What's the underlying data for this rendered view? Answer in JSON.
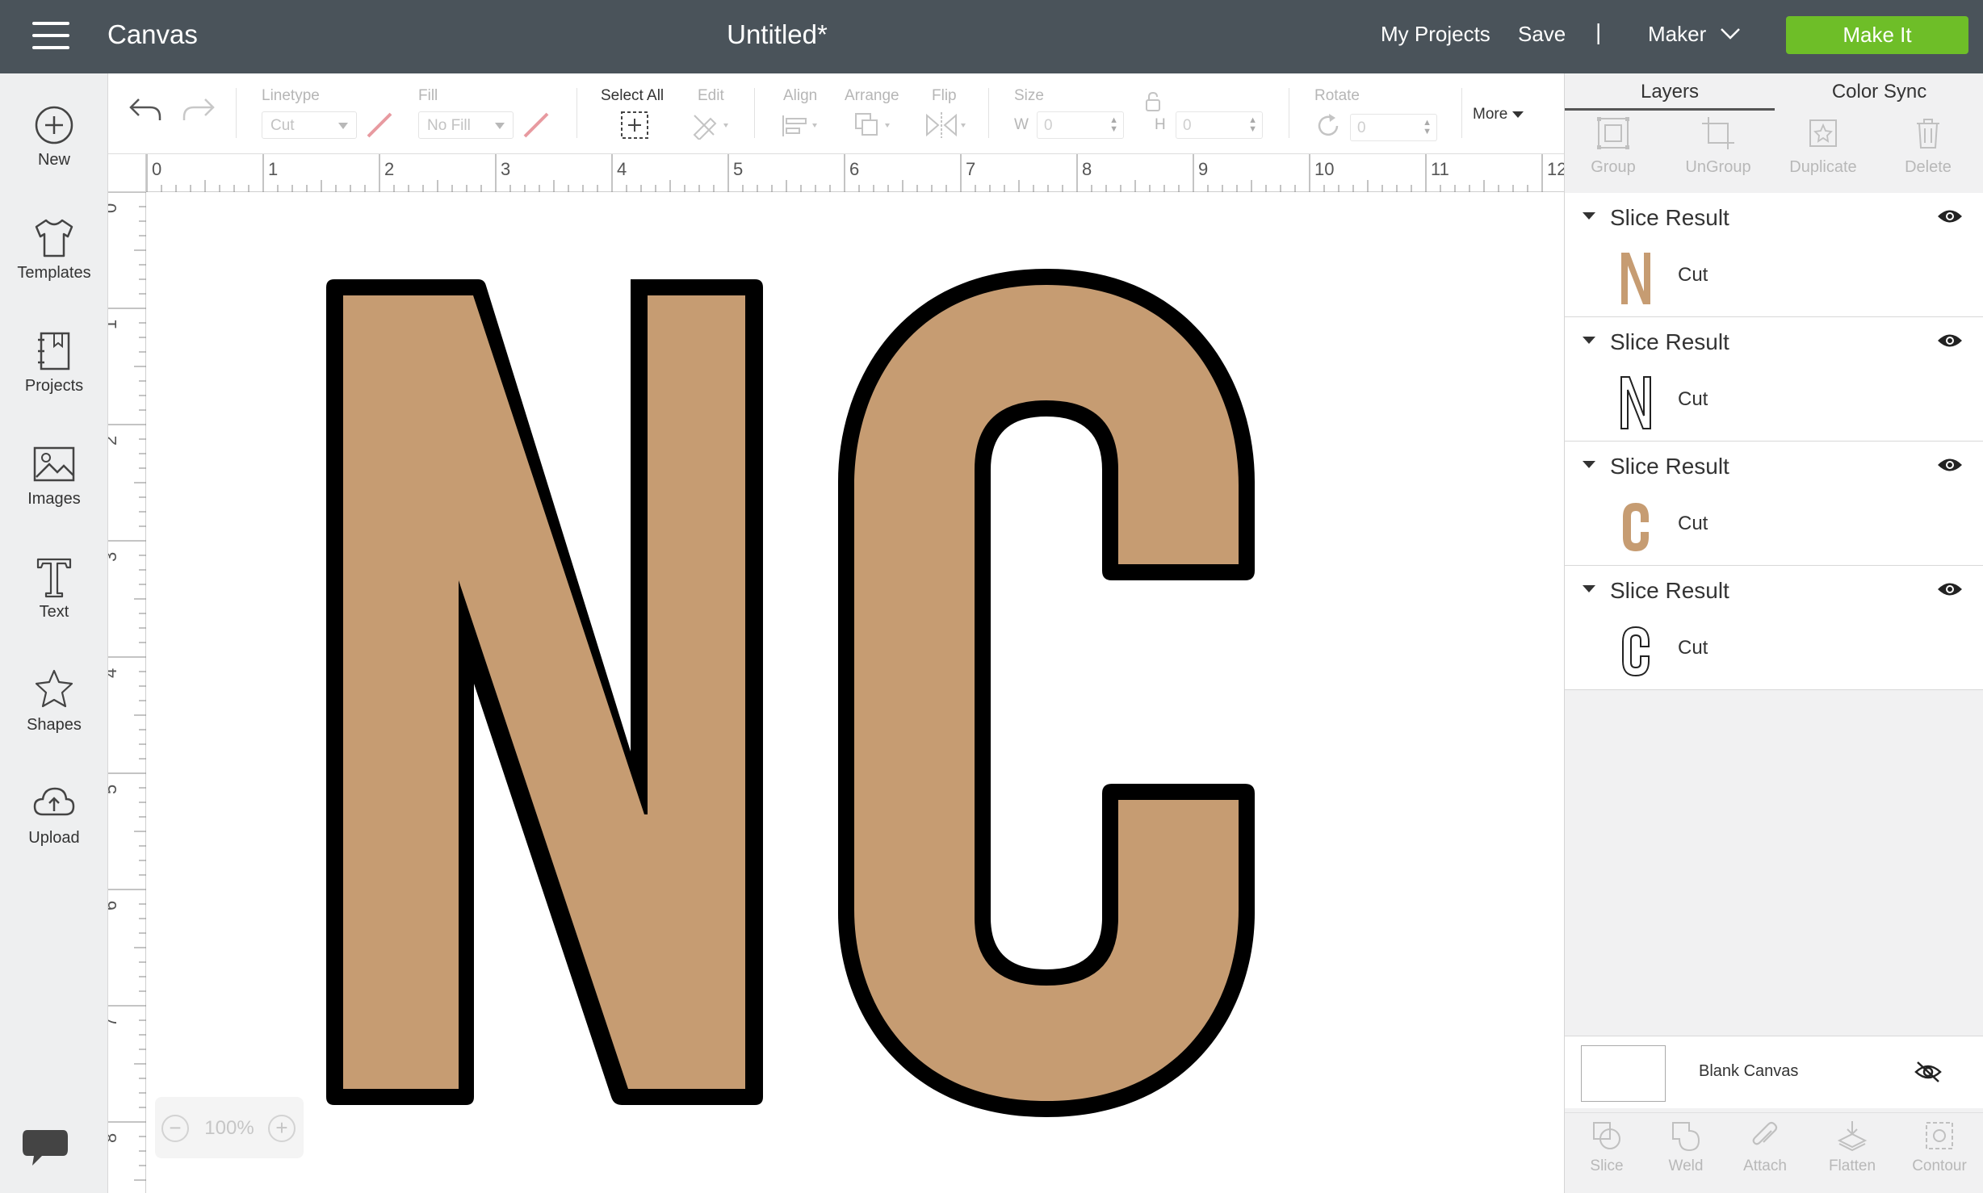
{
  "topbar": {
    "app_title": "Canvas",
    "doc_title": "Untitled*",
    "my_projects": "My Projects",
    "save": "Save",
    "separator": "|",
    "machine": "Maker",
    "make_it": "Make It",
    "make_it_color": "#6ebe28",
    "bar_color": "#4a535a"
  },
  "leftnav": {
    "items": [
      {
        "label": "New",
        "icon": "plus-circle-icon"
      },
      {
        "label": "Templates",
        "icon": "tshirt-icon"
      },
      {
        "label": "Projects",
        "icon": "projects-icon"
      },
      {
        "label": "Images",
        "icon": "image-icon"
      },
      {
        "label": "Text",
        "icon": "text-icon"
      },
      {
        "label": "Shapes",
        "icon": "shapes-icon"
      },
      {
        "label": "Upload",
        "icon": "upload-cloud-icon"
      }
    ]
  },
  "toolbar": {
    "linetype_label": "Linetype",
    "linetype_value": "Cut",
    "fill_label": "Fill",
    "fill_value": "No Fill",
    "select_all": "Select All",
    "edit": "Edit",
    "align": "Align",
    "arrange": "Arrange",
    "flip": "Flip",
    "size": "Size",
    "w_label": "W",
    "w_value": "0",
    "h_label": "H",
    "h_value": "0",
    "rotate": "Rotate",
    "rotate_value": "0",
    "more": "More"
  },
  "rulers": {
    "horizontal": [
      "0",
      "1",
      "2",
      "3",
      "4",
      "5",
      "6",
      "7",
      "8",
      "9",
      "10",
      "11",
      "12"
    ],
    "vertical": [
      "0",
      "1",
      "2",
      "3",
      "4",
      "5",
      "6",
      "7",
      "8"
    ]
  },
  "canvas": {
    "zoom": "100%",
    "letter_fill": "#c69c72",
    "outline_color": "#000000"
  },
  "panel": {
    "tabs": [
      "Layers",
      "Color Sync"
    ],
    "tools": [
      "Group",
      "UnGroup",
      "Duplicate",
      "Delete"
    ],
    "layers": [
      {
        "title": "Slice Result",
        "op": "Cut",
        "glyph": "N",
        "style": "filled"
      },
      {
        "title": "Slice Result",
        "op": "Cut",
        "glyph": "N",
        "style": "outline"
      },
      {
        "title": "Slice Result",
        "op": "Cut",
        "glyph": "C",
        "style": "filled"
      },
      {
        "title": "Slice Result",
        "op": "Cut",
        "glyph": "C",
        "style": "outline"
      }
    ],
    "blank_canvas": "Blank Canvas",
    "bottom_tools": [
      "Slice",
      "Weld",
      "Attach",
      "Flatten",
      "Contour"
    ]
  }
}
